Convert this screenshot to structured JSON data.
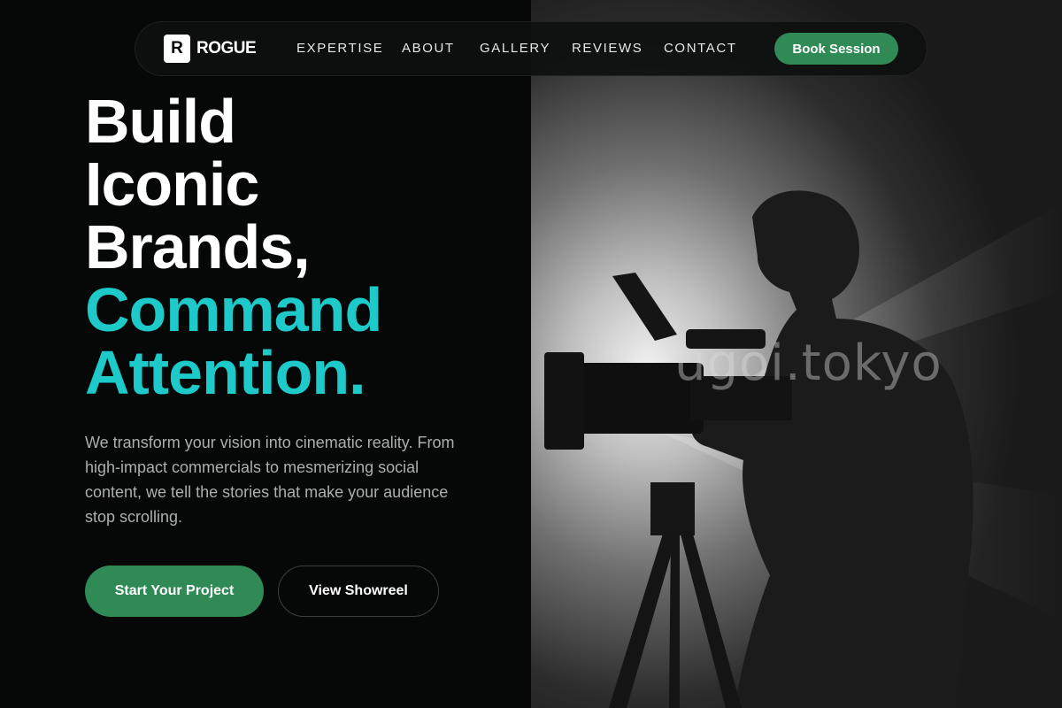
{
  "brand": {
    "logo_letter": "R",
    "name": "ROGUE"
  },
  "nav": {
    "links": [
      "EXPERTISE",
      "ABOUT",
      "GALLERY",
      "REVIEWS",
      "CONTACT"
    ],
    "cta_label": "Book Session"
  },
  "hero": {
    "headline_lines": [
      "Build",
      "Iconic",
      "Brands,"
    ],
    "accent_lines": [
      "Command",
      "Attention."
    ],
    "intro": "We transform your vision into cinematic reality. From high-impact commercials to mesmerizing social content, we tell the stories that make your audience stop scrolling.",
    "primary_cta": "Start Your Project",
    "secondary_cta": "View Showreel"
  },
  "image": {
    "watermark": "ugoi.tokyo"
  },
  "colors": {
    "accent": "#1ec9c9",
    "brand_green": "#2f8a55",
    "background": "#050806"
  },
  "icons": [
    "logo-mark-icon"
  ]
}
